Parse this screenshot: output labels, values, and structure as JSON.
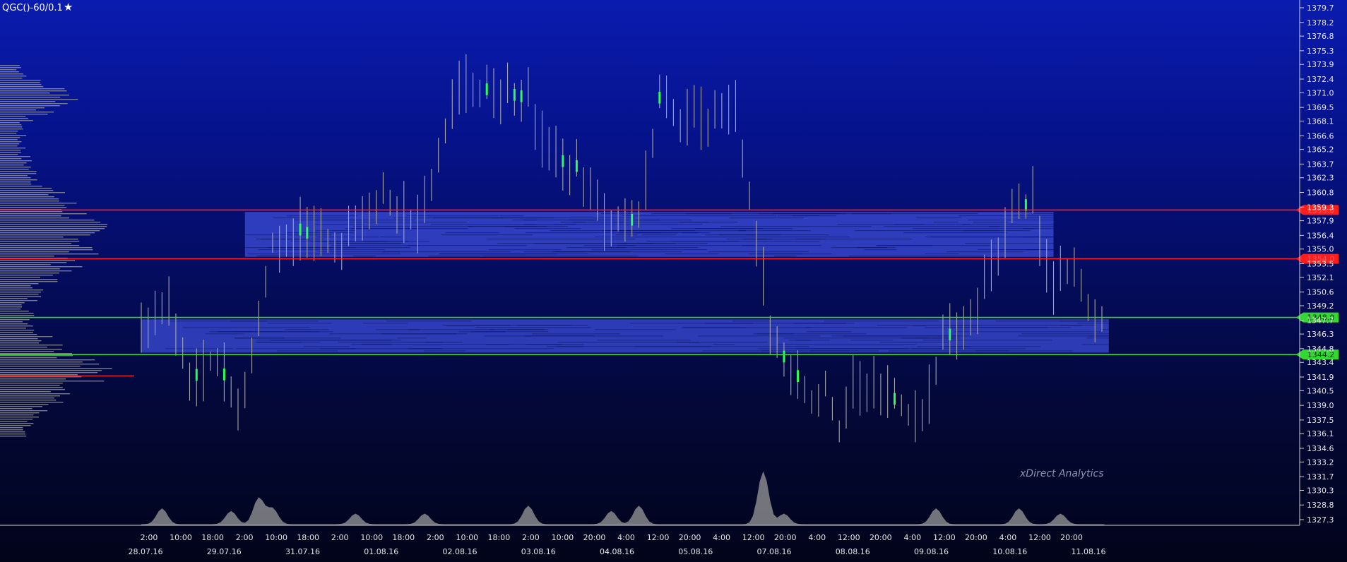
{
  "header": {
    "title": "QGC()-60/0.1"
  },
  "watermark": "xDirect Analytics",
  "colors": {
    "price_bar": "#a7a7a7",
    "price_bar_highlight": "#2bff50",
    "resistance_line": "#ff1e1e",
    "support_line": "#33d633",
    "zone_fill": "#3a4ad4",
    "volume_profile": "#8f8f8f",
    "volume_profile_poc": "#e02020",
    "volume_area": "#9a9a9a",
    "axis_text": "#e6e6e6"
  },
  "chart_data": {
    "type": "ohlc",
    "y_axis": {
      "range": [
        1326.3,
        1380.5
      ],
      "ticks": [
        "1379.7",
        "1378.2",
        "1376.8",
        "1375.3",
        "1373.9",
        "1372.4",
        "1371.0",
        "1369.5",
        "1368.1",
        "1366.6",
        "1365.2",
        "1363.7",
        "1362.3",
        "1360.8",
        "1359.3",
        "1357.9",
        "1356.4",
        "1355.0",
        "1353.5",
        "1352.1",
        "1350.6",
        "1349.2",
        "1347.7",
        "1346.3",
        "1344.8",
        "1343.4",
        "1341.9",
        "1340.5",
        "1339.0",
        "1337.5",
        "1336.1",
        "1334.6",
        "1333.2",
        "1331.7",
        "1330.3",
        "1328.8",
        "1327.3"
      ]
    },
    "x_axis": {
      "time_ticks": [
        "2:00",
        "10:00",
        "18:00",
        "2:00",
        "10:00",
        "18:00",
        "2:00",
        "10:00",
        "18:00",
        "2:00",
        "10:00",
        "18:00",
        "2:00",
        "10:00",
        "20:00",
        "4:00",
        "12:00",
        "20:00",
        "4:00",
        "12:00",
        "20:00",
        "4:00",
        "12:00",
        "20:00",
        "4:00",
        "12:00",
        "20:00",
        "4:00",
        "12:00",
        "20:00"
      ],
      "date_ticks": [
        "28.07.16",
        "29.07.16",
        "31.07.16",
        "01.08.16",
        "02.08.16",
        "03.08.16",
        "04.08.16",
        "05.08.16",
        "07.08.16",
        "08.08.16",
        "09.08.16",
        "10.08.16",
        "11.08.16"
      ]
    },
    "levels": [
      {
        "label": "1359.0",
        "value": 1359.0,
        "kind": "resistance"
      },
      {
        "label": "1354.0",
        "value": 1354.0,
        "kind": "resistance"
      },
      {
        "label": "1348.0",
        "value": 1348.0,
        "kind": "support"
      },
      {
        "label": "1344.2",
        "value": 1344.2,
        "kind": "support"
      }
    ],
    "zones": [
      {
        "from": 1354.2,
        "to": 1358.8,
        "start_index": 15,
        "end_index": 132
      },
      {
        "from": 1344.4,
        "to": 1347.8,
        "start_index": 0,
        "end_index": 140
      }
    ],
    "price_path": [
      {
        "index": 0,
        "price": 1346.5
      },
      {
        "index": 4,
        "price": 1349.0
      },
      {
        "index": 7,
        "price": 1341.5
      },
      {
        "index": 11,
        "price": 1344.0
      },
      {
        "index": 14,
        "price": 1338.5
      },
      {
        "index": 17,
        "price": 1347.5
      },
      {
        "index": 19,
        "price": 1355.5
      },
      {
        "index": 23,
        "price": 1357.0
      },
      {
        "index": 29,
        "price": 1355.0
      },
      {
        "index": 33,
        "price": 1359.5
      },
      {
        "index": 35,
        "price": 1360.5
      },
      {
        "index": 40,
        "price": 1357.5
      },
      {
        "index": 43,
        "price": 1364.0
      },
      {
        "index": 46,
        "price": 1372.0
      },
      {
        "index": 49,
        "price": 1371.5
      },
      {
        "index": 56,
        "price": 1370.5
      },
      {
        "index": 59,
        "price": 1364.5
      },
      {
        "index": 63,
        "price": 1363.5
      },
      {
        "index": 67,
        "price": 1358.0
      },
      {
        "index": 72,
        "price": 1358.0
      },
      {
        "index": 75,
        "price": 1370.5
      },
      {
        "index": 78,
        "price": 1368.5
      },
      {
        "index": 83,
        "price": 1368.5
      },
      {
        "index": 86,
        "price": 1369.5
      },
      {
        "index": 90,
        "price": 1352.0
      },
      {
        "index": 91,
        "price": 1346.0
      },
      {
        "index": 95,
        "price": 1342.0
      },
      {
        "index": 97,
        "price": 1339.0
      },
      {
        "index": 99,
        "price": 1341.0
      },
      {
        "index": 101,
        "price": 1336.5
      },
      {
        "index": 103,
        "price": 1341.0
      },
      {
        "index": 108,
        "price": 1340.5
      },
      {
        "index": 111,
        "price": 1338.0
      },
      {
        "index": 113,
        "price": 1337.5
      },
      {
        "index": 116,
        "price": 1346.0
      },
      {
        "index": 120,
        "price": 1347.0
      },
      {
        "index": 123,
        "price": 1353.5
      },
      {
        "index": 126,
        "price": 1358.5
      },
      {
        "index": 128,
        "price": 1359.5
      },
      {
        "index": 129,
        "price": 1362.0
      },
      {
        "index": 130,
        "price": 1356.0
      },
      {
        "index": 132,
        "price": 1351.5
      },
      {
        "index": 134,
        "price": 1352.5
      },
      {
        "index": 136,
        "price": 1352.0
      },
      {
        "index": 137,
        "price": 1348.5
      },
      {
        "index": 139,
        "price": 1348.0
      }
    ],
    "bar_count": 140,
    "volume_peaks": [
      {
        "index": 3,
        "volume": 0.3
      },
      {
        "index": 13,
        "volume": 0.25
      },
      {
        "index": 17,
        "volume": 0.5
      },
      {
        "index": 19,
        "volume": 0.3
      },
      {
        "index": 31,
        "volume": 0.2
      },
      {
        "index": 41,
        "volume": 0.2
      },
      {
        "index": 56,
        "volume": 0.35
      },
      {
        "index": 68,
        "volume": 0.25
      },
      {
        "index": 72,
        "volume": 0.35
      },
      {
        "index": 90,
        "volume": 1.0
      },
      {
        "index": 93,
        "volume": 0.2
      },
      {
        "index": 115,
        "volume": 0.3
      },
      {
        "index": 127,
        "volume": 0.3
      },
      {
        "index": 133,
        "volume": 0.2
      }
    ],
    "volume_profile_poc_price": 1342.0
  }
}
